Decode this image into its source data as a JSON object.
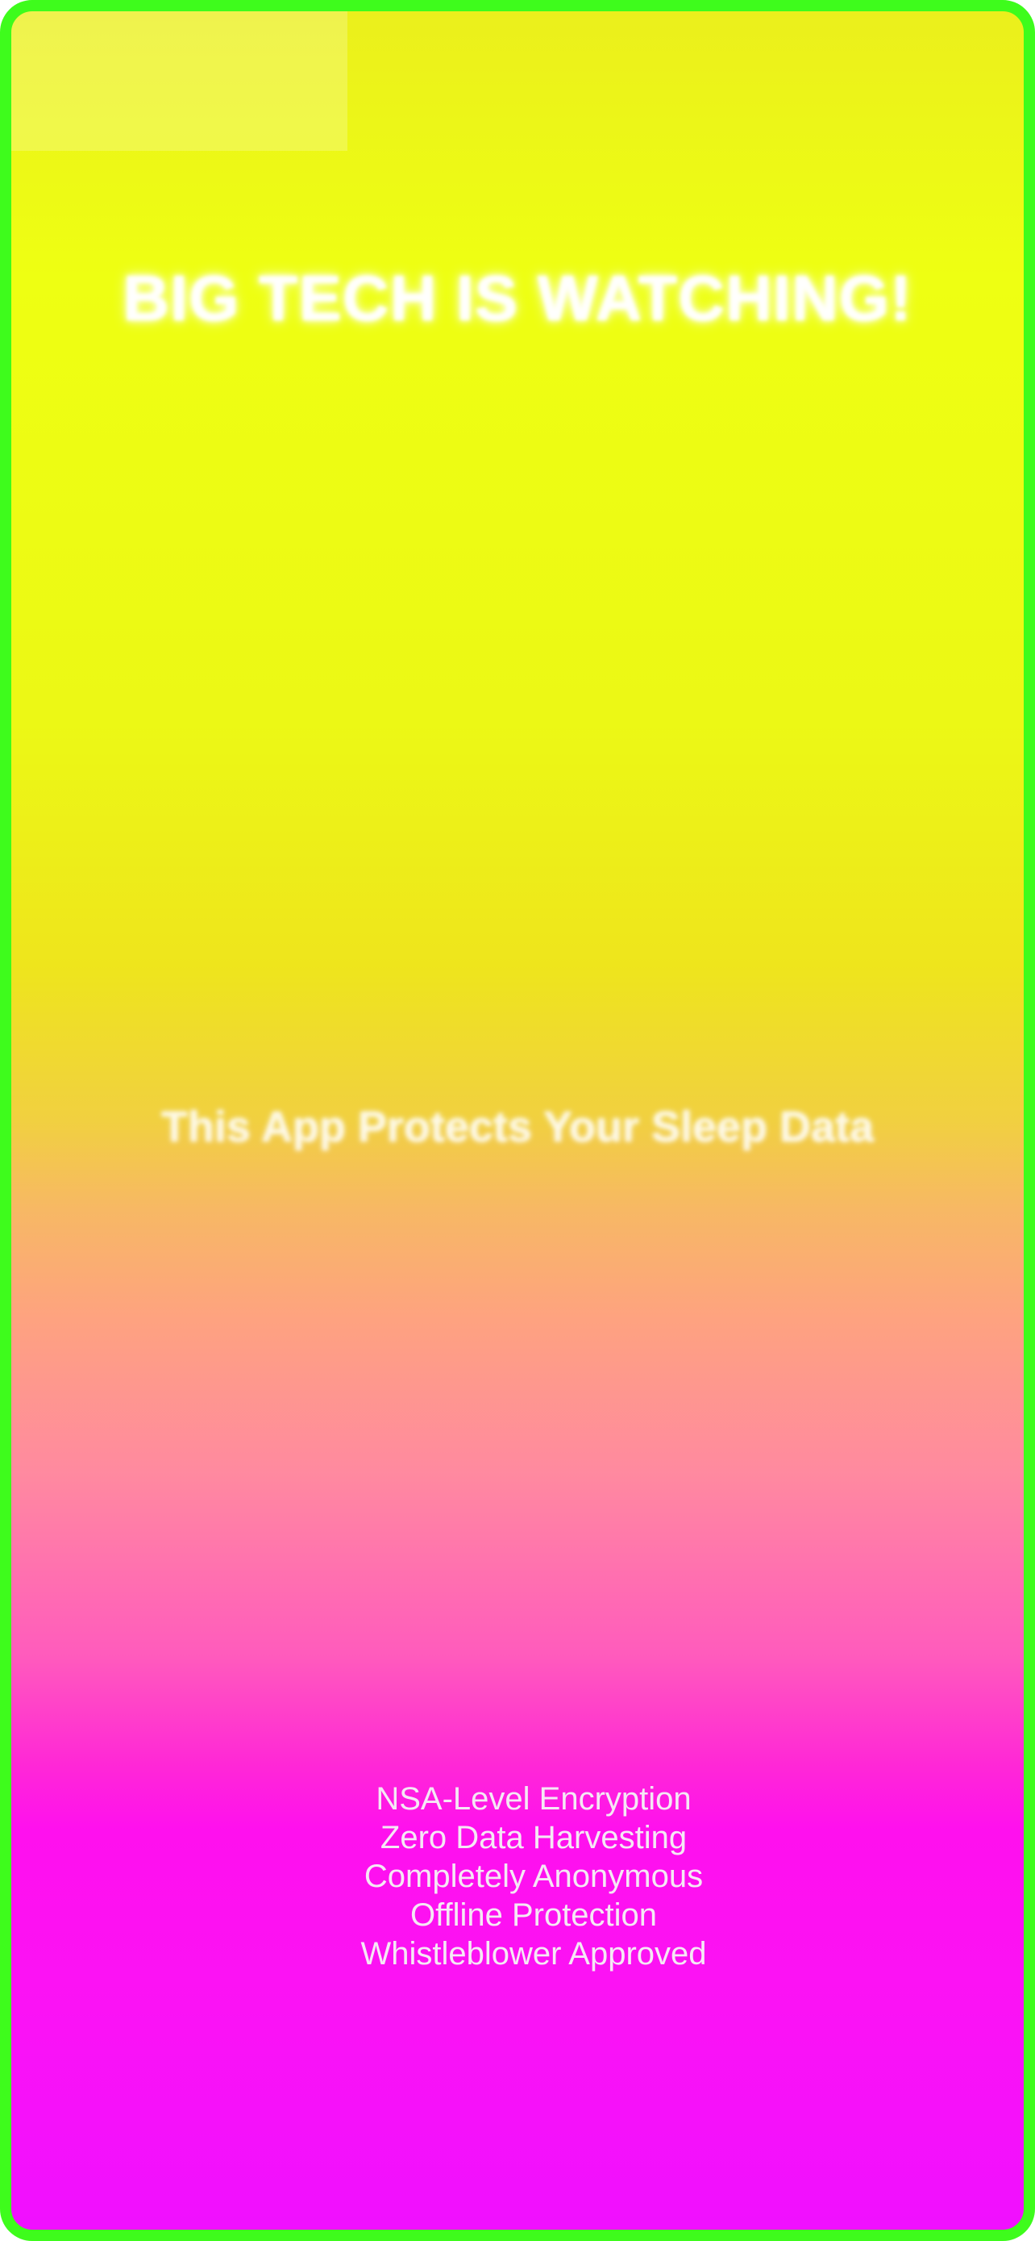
{
  "headline": "BIG TECH IS WATCHING!",
  "subheadline": "This App Protects Your Sleep Data",
  "features": [
    "NSA-Level Encryption",
    "Zero Data Harvesting",
    "Completely Anonymous",
    "Offline Protection",
    "Whistleblower Approved"
  ],
  "colors": {
    "border": "#3efc1c",
    "gradient_top": "#ebef1c",
    "gradient_middle": "#fea280",
    "gradient_bottom": "#f010ff",
    "text": "#ffffff"
  }
}
